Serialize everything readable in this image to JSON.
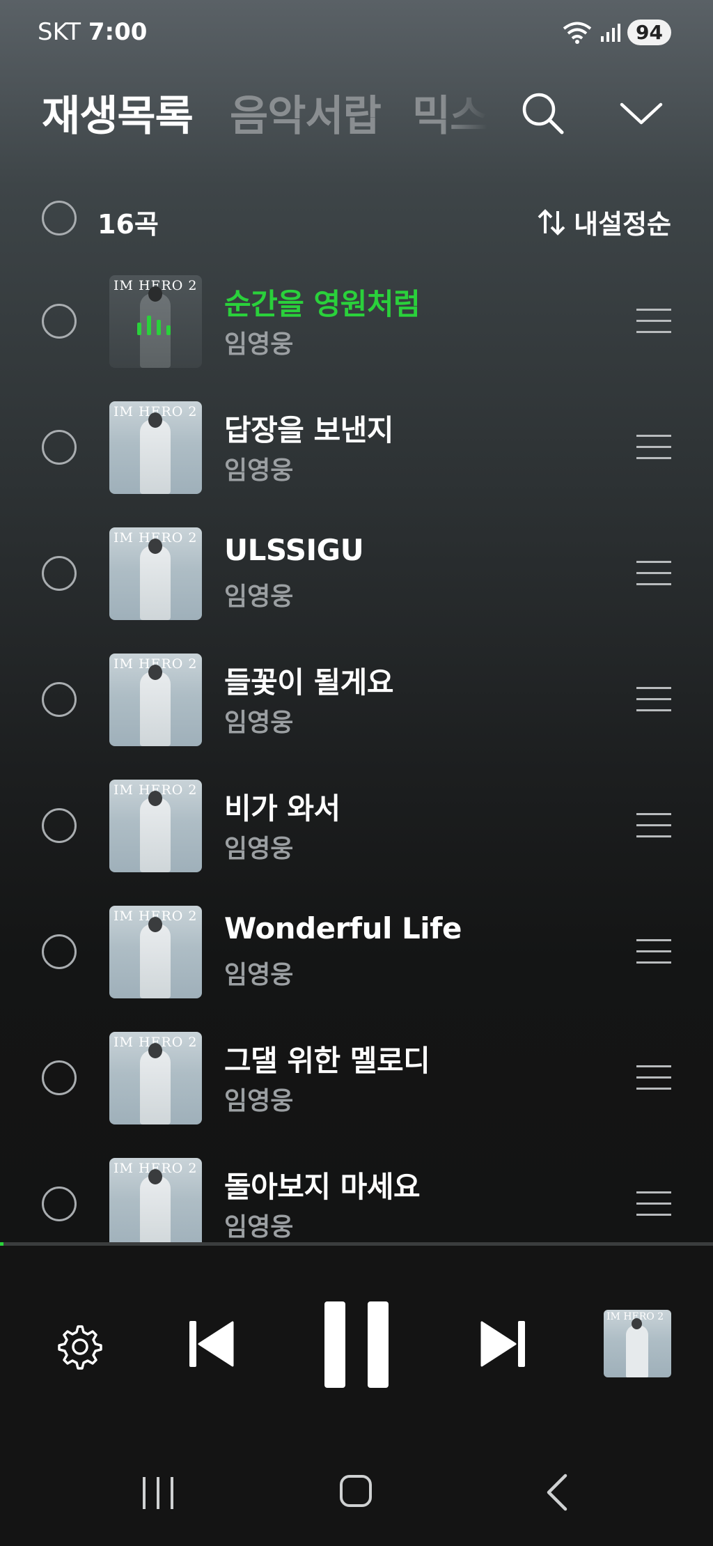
{
  "status": {
    "carrier": "SKT",
    "time": "7:00",
    "battery": "94"
  },
  "tabs": [
    "재생목록",
    "음악서랍",
    "믹스"
  ],
  "list_header": {
    "count": "16곡",
    "sort_label": "내설정순"
  },
  "album": {
    "title": "IM HERO 2"
  },
  "tracks": [
    {
      "title": "순간을 영원처럼",
      "artist": "임영웅",
      "playing": true
    },
    {
      "title": "답장을 보낸지",
      "artist": "임영웅"
    },
    {
      "title": "ULSSIGU",
      "artist": "임영웅"
    },
    {
      "title": "들꽃이 될게요",
      "artist": "임영웅"
    },
    {
      "title": "비가 와서",
      "artist": "임영웅"
    },
    {
      "title": "Wonderful Life",
      "artist": "임영웅"
    },
    {
      "title": "그댈 위한 멜로디",
      "artist": "임영웅"
    },
    {
      "title": "돌아보지 마세요",
      "artist": "임영웅"
    }
  ],
  "player": {
    "progress": 0.005
  },
  "colors": {
    "accent": "#2ad13b",
    "muted": "#9b9fa2"
  }
}
